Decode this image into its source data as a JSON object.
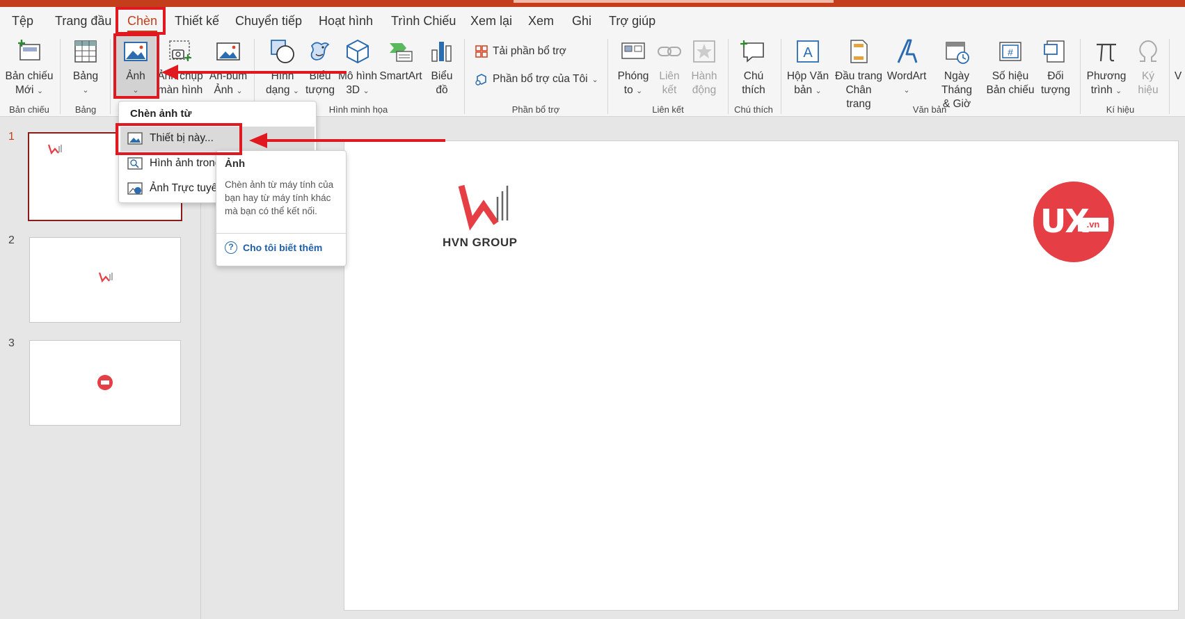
{
  "tabs": [
    "Tệp",
    "Trang đầu",
    "Chèn",
    "Thiết kế",
    "Chuyển tiếp",
    "Hoạt hình",
    "Trình Chiếu",
    "Xem lại",
    "Xem",
    "Ghi",
    "Trợ giúp"
  ],
  "ribbon": {
    "new_slide": {
      "l1": "Bản chiếu",
      "l2": "Mới"
    },
    "table": {
      "l1": "Bảng"
    },
    "pictures": {
      "l1": "Ảnh"
    },
    "screenshot": {
      "l1": "Ảnh chụp",
      "l2": "màn hình"
    },
    "album": {
      "l1": "An-bum",
      "l2": "Ảnh"
    },
    "shapes": {
      "l1": "Hình",
      "l2": "dạng"
    },
    "icons": {
      "l1": "Biểu",
      "l2": "tượng"
    },
    "models3d": {
      "l1": "Mô hình",
      "l2": "3D"
    },
    "smartart": {
      "l1": "SmartArt"
    },
    "chart": {
      "l1": "Biểu",
      "l2": "đồ"
    },
    "get_addins": "Tải phần bổ trợ",
    "my_addins": "Phần bổ trợ của Tôi",
    "zoom": {
      "l1": "Phóng",
      "l2": "to"
    },
    "link": {
      "l1": "Liên",
      "l2": "kết"
    },
    "action": {
      "l1": "Hành",
      "l2": "động"
    },
    "comment": {
      "l1": "Chú",
      "l2": "thích"
    },
    "textbox": {
      "l1": "Hộp Văn",
      "l2": "bản"
    },
    "header_footer": {
      "l1": "Đầu trang",
      "l2": "Chân trang"
    },
    "wordart": {
      "l1": "WordArt"
    },
    "date_time": {
      "l1": "Ngày Tháng",
      "l2": "& Giờ"
    },
    "slide_number": {
      "l1": "Số hiệu",
      "l2": "Bản chiếu"
    },
    "object": {
      "l1": "Đối",
      "l2": "tượng"
    },
    "equation": {
      "l1": "Phương",
      "l2": "trình"
    },
    "symbol": {
      "l1": "Ký",
      "l2": "hiệu"
    },
    "video_partial": "V"
  },
  "groups": {
    "slides": "Bản chiếu",
    "tables": "Bảng",
    "illustrations": "Hình minh họa",
    "addins": "Phần bổ trợ",
    "links": "Liên kết",
    "comments": "Chú thích",
    "text": "Văn bản",
    "symbols": "Kí hiệu"
  },
  "menu": {
    "header": "Chèn ảnh từ",
    "items": [
      "Thiết bị này...",
      "Hình ảnh trong",
      "Ảnh Trực tuyến"
    ]
  },
  "tooltip": {
    "title": "Ảnh",
    "body": "Chèn ảnh từ máy tính của bạn hay từ máy tính khác mà bạn có thể kết nối.",
    "link": "Cho tôi biết thêm"
  },
  "thumbs": [
    "1",
    "2",
    "3"
  ],
  "slide": {
    "logo_text": "HVN GROUP",
    "ux_text": "UX",
    "ux_suffix": ".vn"
  },
  "colors": {
    "accent": "#c43e1c",
    "highlight": "#e0181f",
    "ux_red": "#e53e45"
  }
}
